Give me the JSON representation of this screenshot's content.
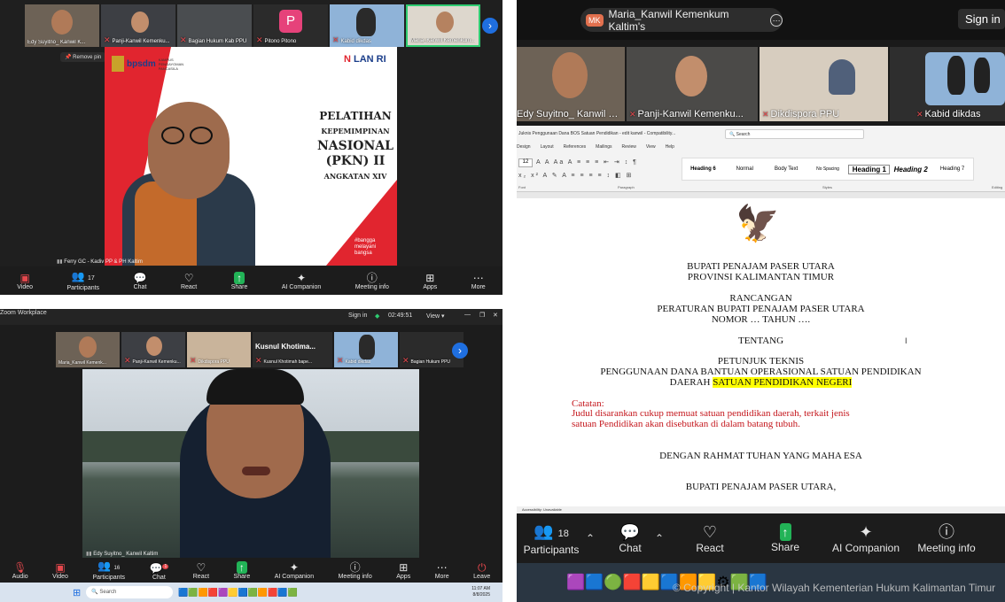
{
  "top_left": {
    "thumbs": [
      {
        "label": "Edy Suyitno_ Kanwil K..."
      },
      {
        "label": "Panji-Kanwil Kemenku..."
      },
      {
        "label": "Bagian Hukum Kab PPU"
      },
      {
        "label": "Pitono Pitono",
        "initial": "P"
      },
      {
        "label": "Kabid dikdas"
      },
      {
        "label": "Maria_Kanwil Kemenkum..."
      }
    ],
    "remove_pin": "Remove pin",
    "slide": {
      "brand": "bpsdm",
      "brand_sub": "KAMPUS PENGAYOMAN PANCASILA",
      "lan": "LAN RI",
      "title_lines": [
        "PELATIHAN",
        "KEPEMIMPINAN",
        "NASIONAL",
        "(PKN) II",
        "ANGKATAN XIV"
      ],
      "hashtag": "#bangga melayani bangsa"
    },
    "speaker_name": "Ferry GC - Kadiv PP & PH Kaltim",
    "toolbar": [
      {
        "label": "Video",
        "icon": "video-off-icon"
      },
      {
        "label": "Participants",
        "count": "17",
        "icon": "participants-icon"
      },
      {
        "label": "Chat",
        "icon": "chat-icon"
      },
      {
        "label": "React",
        "icon": "heart-icon"
      },
      {
        "label": "Share",
        "icon": "share-icon"
      },
      {
        "label": "AI Companion",
        "icon": "sparkle-icon"
      },
      {
        "label": "Meeting info",
        "icon": "info-icon"
      },
      {
        "label": "Apps",
        "icon": "apps-icon"
      },
      {
        "label": "More",
        "icon": "more-icon"
      }
    ]
  },
  "bottom_left": {
    "window_title": "Zoom Workplace",
    "sign_in": "Sign in",
    "timer": "02:49:51",
    "view": "View",
    "thumbs": [
      {
        "label": "Maria_Kanwil Kemenk..."
      },
      {
        "label": "Panji-Kanwil Kemenku..."
      },
      {
        "label": "Dikdispora PPU"
      },
      {
        "label": "Kusnul Khotimah bape...",
        "title": "Kusnul  Khotima..."
      },
      {
        "label": "Kabid dikdas"
      },
      {
        "label": "Bagian Hukum PPU"
      }
    ],
    "speaker_name": "Edy Suyitno_ Kanwil Kaltim",
    "toolbar": [
      {
        "label": "Audio"
      },
      {
        "label": "Video"
      },
      {
        "label": "Participants",
        "count": "16"
      },
      {
        "label": "Chat",
        "badge": "1"
      },
      {
        "label": "React"
      },
      {
        "label": "Share"
      },
      {
        "label": "AI Companion"
      },
      {
        "label": "Meeting info"
      },
      {
        "label": "Apps"
      },
      {
        "label": "More"
      },
      {
        "label": "Leave"
      }
    ],
    "taskbar": {
      "search": "Search",
      "time": "11:07 AM",
      "date": "8/8/2025"
    }
  },
  "right": {
    "tab_initials": "MK",
    "tab_title": "Maria_Kanwil Kemenkum Kaltim's",
    "sign_in": "Sign in",
    "thumbs": [
      {
        "label": "Edy Suyitno_ Kanwil K..."
      },
      {
        "label": "Panji-Kanwil Kemenku..."
      },
      {
        "label": "Dikdispora PPU"
      },
      {
        "label": "Kabid dikdas"
      }
    ],
    "word": {
      "title": "Juknis Penggunaan Dana BOS Satuan Pendidikan - edit kanwil - Compatibility...",
      "search": "Search",
      "menus": [
        "Design",
        "Layout",
        "References",
        "Mailings",
        "Review",
        "View",
        "Help"
      ],
      "font_size": "12",
      "styles": [
        "Heading 6",
        "Normal",
        "Body Text",
        "No Spacing",
        "Heading 1",
        "Heading 2",
        "Heading 7"
      ],
      "group_labels": [
        "Font",
        "Paragraph",
        "Styles",
        "Editing"
      ],
      "status": "Accessibility: Unavailable"
    },
    "doc": {
      "l1": "BUPATI PENAJAM PASER UTARA",
      "l2": "PROVINSI KALIMANTAN TIMUR",
      "l3": "RANCANGAN",
      "l4": "PERATURAN BUPATI PENAJAM PASER UTARA",
      "l5": "NOMOR … TAHUN ….",
      "l6": "TENTANG",
      "l7": "PETUNJUK TEKNIS",
      "l8": "PENGGUNAAN DANA BANTUAN OPERASIONAL SATUAN PENDIDIKAN",
      "l9a": "DAERAH ",
      "l9b": "SATUAN PENDIDIKAN NEGERI",
      "note_title": "Catatan:",
      "note1": "Judul disarankan cukup memuat satuan pendidikan daerah, terkait jenis",
      "note2": "satuan Pendidikan akan disebutkan di dalam batang tubuh.",
      "l10": "DENGAN RAHMAT TUHAN YANG MAHA ESA",
      "l11": "BUPATI PENAJAM PASER UTARA,"
    },
    "toolbar": [
      {
        "label": "Participants",
        "count": "18"
      },
      {
        "label": "Chat"
      },
      {
        "label": "React"
      },
      {
        "label": "Share"
      },
      {
        "label": "AI Companion"
      },
      {
        "label": "Meeting info"
      }
    ],
    "watermark": "© Copyright | Kantor Wilayah Kementerian Hukum Kalimantan Timur"
  }
}
